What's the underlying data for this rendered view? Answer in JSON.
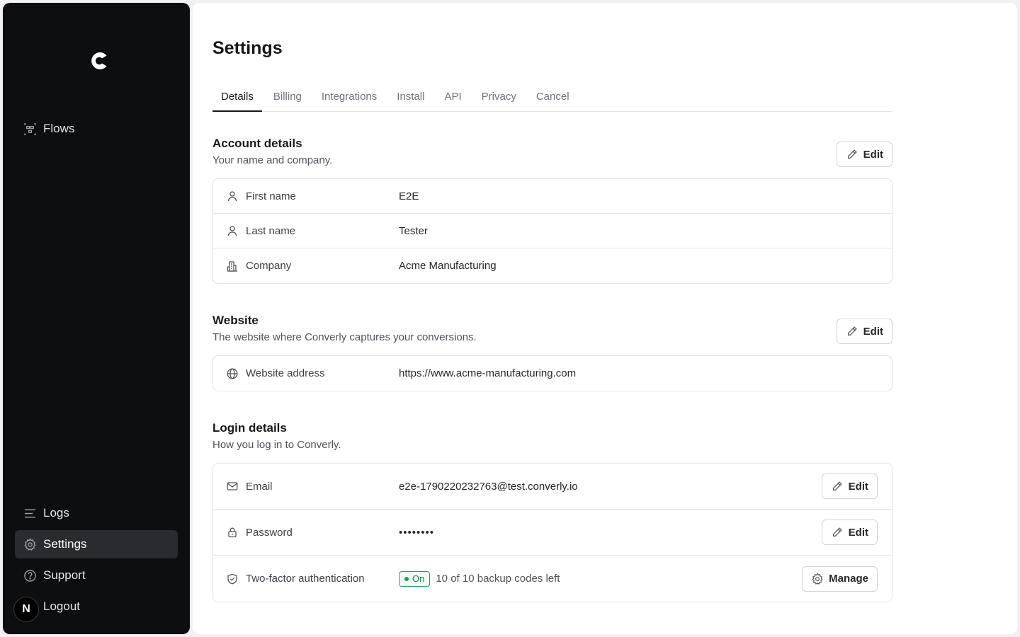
{
  "sidebar": {
    "logo_letter": "C",
    "items": [
      {
        "label": "Flows",
        "icon": "flows-icon"
      },
      {
        "label": "Logs",
        "icon": "logs-icon"
      },
      {
        "label": "Settings",
        "icon": "gear-icon",
        "active": true
      },
      {
        "label": "Support",
        "icon": "help-circle-icon"
      },
      {
        "label": "Logout",
        "icon": "avatar"
      }
    ],
    "avatar_letter": "N"
  },
  "page": {
    "title": "Settings"
  },
  "tabs": [
    "Details",
    "Billing",
    "Integrations",
    "Install",
    "API",
    "Privacy",
    "Cancel"
  ],
  "active_tab": "Details",
  "account": {
    "title": "Account details",
    "subtitle": "Your name and company.",
    "edit_label": "Edit",
    "rows": [
      {
        "label": "First name",
        "value": "E2E",
        "icon": "user-icon"
      },
      {
        "label": "Last name",
        "value": "Tester",
        "icon": "user-icon"
      },
      {
        "label": "Company",
        "value": "Acme Manufacturing",
        "icon": "building-icon"
      }
    ]
  },
  "website": {
    "title": "Website",
    "subtitle": "The website where Converly captures your conversions.",
    "edit_label": "Edit",
    "rows": [
      {
        "label": "Website address",
        "value": "https://www.acme-manufacturing.com",
        "icon": "globe-icon"
      }
    ]
  },
  "login": {
    "title": "Login details",
    "subtitle": "How you log in to Converly.",
    "rows": [
      {
        "label": "Email",
        "value": "e2e-1790220232763@test.converly.io",
        "icon": "mail-icon",
        "button": "Edit"
      },
      {
        "label": "Password",
        "value": "••••••••",
        "icon": "lock-icon",
        "button": "Edit"
      },
      {
        "label": "Two-factor authentication",
        "badge": "On",
        "value": "10 of 10 backup codes left",
        "icon": "shield-check-icon",
        "button": "Manage"
      }
    ]
  },
  "colors": {
    "sidebar_bg": "#0d0e11",
    "active_item_bg": "#2a2b31",
    "badge_green": "#16a34a"
  }
}
